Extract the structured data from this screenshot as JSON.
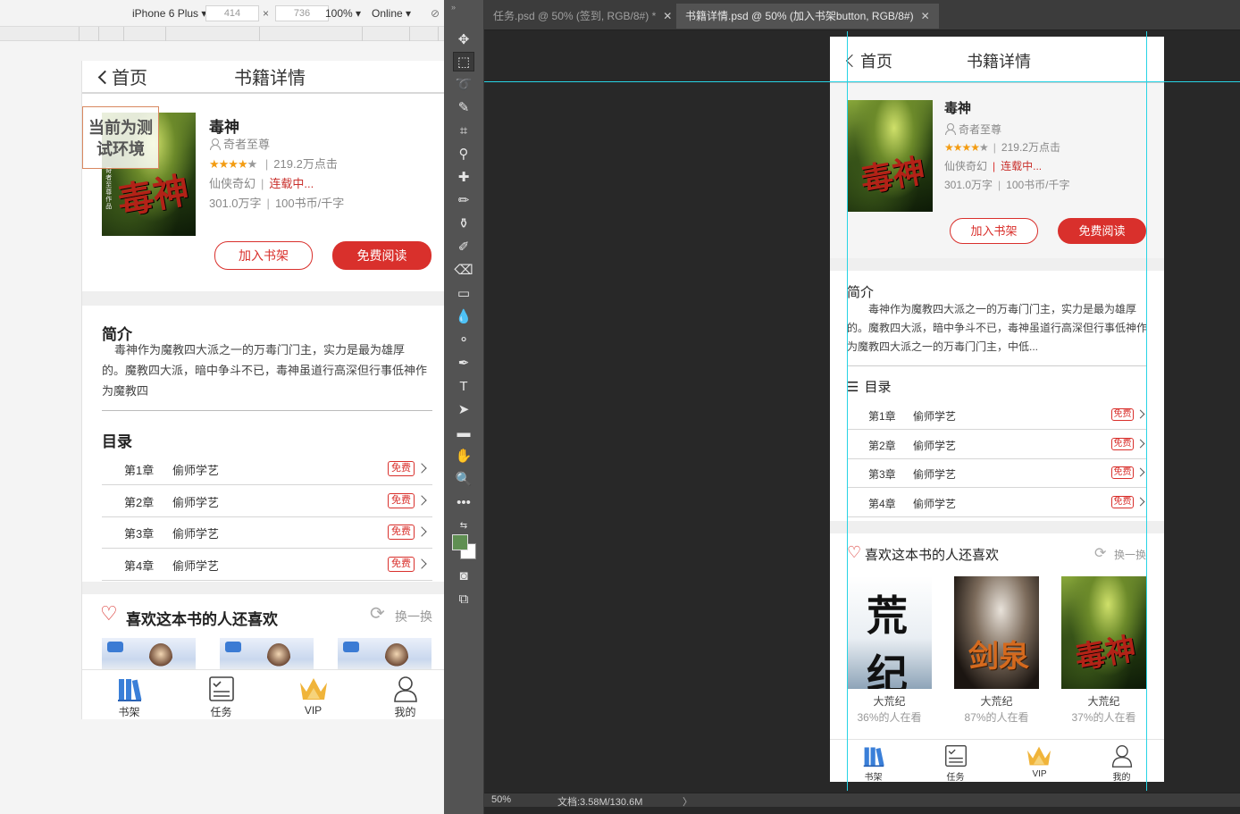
{
  "browser": {
    "device": "iPhone 6 Plus",
    "width": "414",
    "height": "736",
    "zoom": "100%",
    "network": "Online"
  },
  "phone": {
    "nav": {
      "back_label": "首页",
      "title": "书籍详情"
    },
    "test_banner": "当前为测试环境",
    "book": {
      "title": "毒神",
      "author": "奇者至尊",
      "clicks": "219.2万点击",
      "genre": "仙侠奇幻",
      "status": "连载中...",
      "words": "301.0万字",
      "price": "100书币/千字",
      "cover_text": "毒神",
      "cover_small": "奇者至尊作品",
      "rating": 4
    },
    "actions": {
      "add_shelf": "加入书架",
      "read_free": "免费阅读"
    },
    "intro": {
      "heading": "简介",
      "text": "毒神作为魔教四大派之一的万毒门门主，实力是最为雄厚的。魔教四大派，暗中争斗不已，毒神虽道行高深但行事低神作为魔教四"
    },
    "toc": {
      "heading": "目录",
      "chapters": [
        {
          "num": "第1章",
          "title": "偷师学艺",
          "tag": "免费"
        },
        {
          "num": "第2章",
          "title": "偷师学艺",
          "tag": "免费"
        },
        {
          "num": "第3章",
          "title": "偷师学艺",
          "tag": "免费"
        },
        {
          "num": "第4章",
          "title": "偷师学艺",
          "tag": "免费"
        }
      ]
    },
    "recommend": {
      "heading": "喜欢这本书的人还喜欢",
      "refresh": "换一换"
    },
    "tabs": [
      "书架",
      "任务",
      "VIP",
      "我的"
    ]
  },
  "photoshop": {
    "doc_tabs": [
      {
        "label": "任务.psd @ 50% (签到, RGB/8#) *"
      },
      {
        "label": "书籍详情.psd @ 50% (加入书架button, RGB/8#)"
      }
    ],
    "status": {
      "zoom": "50%",
      "doc": "文档:3.58M/130.6M"
    },
    "colors": {
      "foreground": "#5f8f52",
      "background": "#ffffff",
      "guide": "#27d4e5",
      "accent": "#d9302c"
    }
  },
  "artboard": {
    "nav": {
      "back_label": "首页",
      "title": "书籍详情"
    },
    "book": {
      "title": "毒神",
      "author": "奇者至尊",
      "clicks": "219.2万点击",
      "genre": "仙侠奇幻",
      "status": "连载中...",
      "words": "301.0万字",
      "price": "100书币/千字"
    },
    "actions": {
      "add_shelf": "加入书架",
      "read_free": "免费阅读"
    },
    "intro": {
      "heading": "简介",
      "text": "毒神作为魔教四大派之一的万毒门门主，实力是最为雄厚的。魔教四大派，暗中争斗不已，毒神虽道行高深但行事低神作为魔教四大派之一的万毒门门主，中低..."
    },
    "toc": {
      "heading": "目录",
      "chapters": [
        {
          "num": "第1章",
          "title": "偷师学艺",
          "tag": "免费"
        },
        {
          "num": "第2章",
          "title": "偷师学艺",
          "tag": "免费"
        },
        {
          "num": "第3章",
          "title": "偷师学艺",
          "tag": "免费"
        },
        {
          "num": "第4章",
          "title": "偷师学艺",
          "tag": "免费"
        }
      ]
    },
    "recommend": {
      "heading": "喜欢这本书的人还喜欢",
      "refresh": "换一换",
      "books": [
        {
          "title": "大荒纪",
          "sub": "36%的人在看",
          "cover_text": "荒纪"
        },
        {
          "title": "大荒纪",
          "sub": "87%的人在看",
          "cover_text": "剑泉"
        },
        {
          "title": "大荒纪",
          "sub": "37%的人在看",
          "cover_text": "毒神"
        }
      ]
    },
    "tabs": [
      "书架",
      "任务",
      "VIP",
      "我的"
    ]
  }
}
